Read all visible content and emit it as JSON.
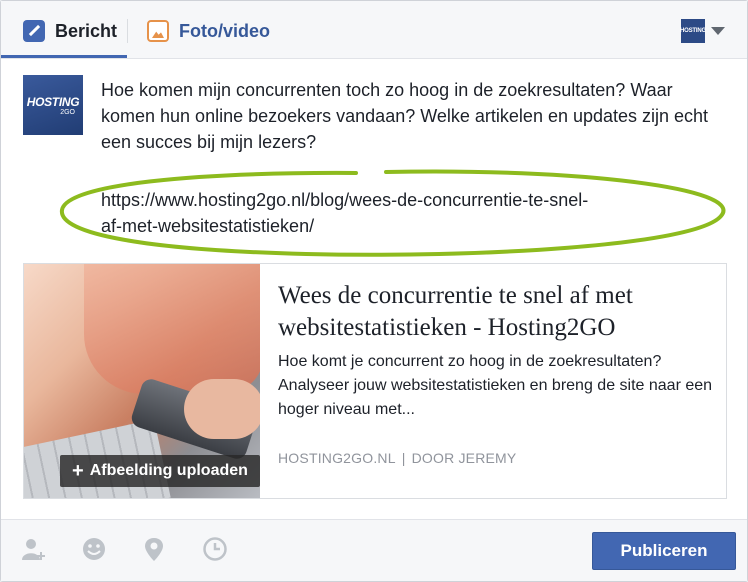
{
  "tabs": {
    "bericht": "Bericht",
    "foto_video": "Foto/video"
  },
  "profile": {
    "avatar_text": "HOSTING",
    "avatar_sub": "2GO",
    "mini_logo": "HOSTING"
  },
  "post": {
    "text": "Hoe komen mijn concurrenten toch zo hoog in de zoekresultaten? Waar komen hun online bezoekers vandaan? Welke artikelen en updates zijn echt een succes bij mijn lezers?",
    "link_line1": "https://www.hosting2go.nl/blog/wees-de-concurrentie-te-snel-",
    "link_line2": "af-met-websitestatistieken/"
  },
  "preview": {
    "upload_label": "Afbeelding uploaden",
    "title": "Wees de concurrentie te snel af met websitestatistieken - Hosting2GO",
    "description": "Hoe komt je concurrent zo hoog in de zoekresultaten? Analyseer jouw websitestatistieken en breng de site naar een hoger niveau met...",
    "domain": "HOSTING2GO.NL",
    "separator": "|",
    "author": "DOOR JEREMY"
  },
  "footer": {
    "icons": [
      "tag-friends-icon",
      "feeling-icon",
      "location-icon",
      "clock-icon"
    ],
    "publish_label": "Publiceren"
  },
  "colors": {
    "accent": "#4267b2",
    "highlight_ellipse": "#8dbb1e"
  }
}
